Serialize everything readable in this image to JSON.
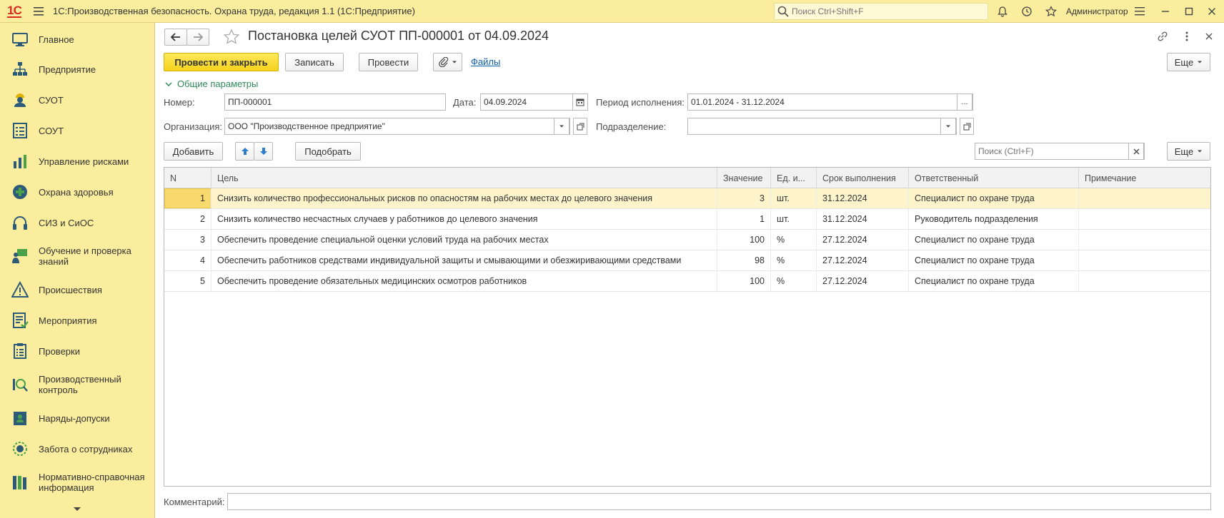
{
  "app": {
    "logo": "1С",
    "title": "1С:Производственная безопасность. Охрана труда, редакция 1.1  (1С:Предприятие)",
    "search_placeholder": "Поиск Ctrl+Shift+F",
    "user": "Администратор"
  },
  "sidebar": {
    "items": [
      {
        "label": "Главное",
        "icon": "monitor-icon"
      },
      {
        "label": "Предприятие",
        "icon": "org-structure-icon"
      },
      {
        "label": "СУОТ",
        "icon": "worker-icon"
      },
      {
        "label": "СОУТ",
        "icon": "checklist-icon"
      },
      {
        "label": "Управление рисками",
        "icon": "risk-chart-icon"
      },
      {
        "label": "Охрана здоровья",
        "icon": "medical-cross-icon"
      },
      {
        "label": "СИЗ и СиОС",
        "icon": "headphones-icon"
      },
      {
        "label": "Обучение и проверка знаний",
        "icon": "teaching-icon"
      },
      {
        "label": "Происшествия",
        "icon": "warning-icon"
      },
      {
        "label": "Мероприятия",
        "icon": "tasks-icon"
      },
      {
        "label": "Проверки",
        "icon": "clipboard-icon"
      },
      {
        "label": "Производственный контроль",
        "icon": "inspection-icon"
      },
      {
        "label": "Наряды-допуски",
        "icon": "permit-icon"
      },
      {
        "label": "Забота о сотрудниках",
        "icon": "care-icon"
      },
      {
        "label": "Нормативно-справочная информация",
        "icon": "books-icon"
      }
    ]
  },
  "document": {
    "title": "Постановка целей СУОТ ПП-000001 от 04.09.2024",
    "toolbar": {
      "post_and_close": "Провести и закрыть",
      "save": "Записать",
      "post": "Провести",
      "files": "Файлы",
      "more": "Еще"
    },
    "section_title": "Общие параметры",
    "fields": {
      "number_label": "Номер:",
      "number_value": "ПП-000001",
      "date_label": "Дата:",
      "date_value": "04.09.2024",
      "period_label": "Период исполнения:",
      "period_value": "01.01.2024 - 31.12.2024",
      "org_label": "Организация:",
      "org_value": "ООО \"Производственное предприятие\"",
      "dept_label": "Подразделение:",
      "dept_value": "",
      "comment_label": "Комментарий:",
      "comment_value": ""
    },
    "table_toolbar": {
      "add": "Добавить",
      "pick": "Подобрать",
      "search_placeholder": "Поиск (Ctrl+F)",
      "more": "Еще"
    },
    "table": {
      "columns": [
        "N",
        "Цель",
        "Значение",
        "Ед. и...",
        "Срок выполнения",
        "Ответственный",
        "Примечание"
      ],
      "rows": [
        {
          "n": "1",
          "goal": "Снизить количество профессиональных рисков по опасностям на рабочих местах до целевого значения",
          "value": "3",
          "unit": "шт.",
          "deadline": "31.12.2024",
          "responsible": "Специалист по охране труда",
          "note": ""
        },
        {
          "n": "2",
          "goal": "Снизить количество несчастных случаев у работников до целевого значения",
          "value": "1",
          "unit": "шт.",
          "deadline": "31.12.2024",
          "responsible": "Руководитель подразделения",
          "note": ""
        },
        {
          "n": "3",
          "goal": "Обеспечить проведение специальной оценки условий труда на рабочих местах",
          "value": "100",
          "unit": "%",
          "deadline": "27.12.2024",
          "responsible": "Специалист по охране труда",
          "note": ""
        },
        {
          "n": "4",
          "goal": "Обеспечить работников средствами индивидуальной защиты и смывающими и обезжиривающими средствами",
          "value": "98",
          "unit": "%",
          "deadline": "27.12.2024",
          "responsible": "Специалист по охране труда",
          "note": ""
        },
        {
          "n": "5",
          "goal": "Обеспечить проведение обязательных медицинских осмотров работников",
          "value": "100",
          "unit": "%",
          "deadline": "27.12.2024",
          "responsible": "Специалист по охране труда",
          "note": ""
        }
      ]
    }
  },
  "colors": {
    "accent_yellow": "#f5d21c",
    "sidebar_bg": "#fbed9e",
    "link_blue": "#0b5fad",
    "section_green": "#2f8a5a",
    "selected_row": "#fdf4cc"
  }
}
